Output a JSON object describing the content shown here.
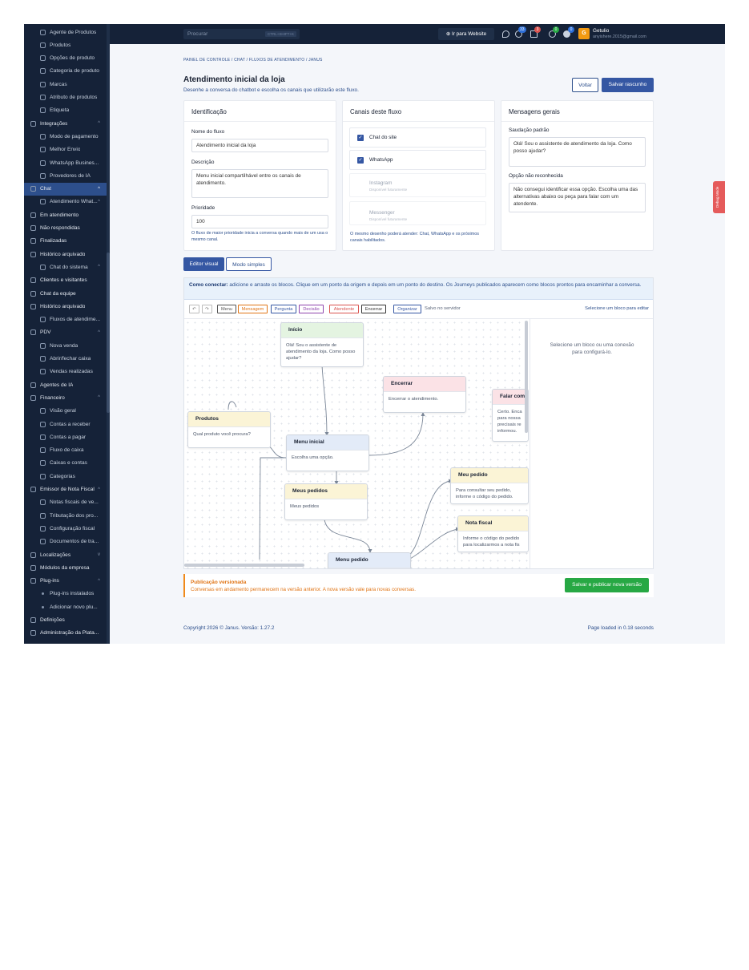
{
  "sidebar": {
    "items": [
      {
        "label": "Agente de Produtos",
        "level": "l1"
      },
      {
        "label": "Produtos",
        "level": "l1"
      },
      {
        "label": "Opções de produto",
        "level": "l1"
      },
      {
        "label": "Categoria de produto",
        "level": "l1"
      },
      {
        "label": "Marcas",
        "level": "l1"
      },
      {
        "label": "Atributo de produtos",
        "level": "l1"
      },
      {
        "label": "Etiqueta",
        "level": "l1"
      },
      {
        "label": "Integrações",
        "level": "l0",
        "caret": "^"
      },
      {
        "label": "Modo de pagamento",
        "level": "l1"
      },
      {
        "label": "Melhor Envio",
        "level": "l1"
      },
      {
        "label": "WhatsApp Busines...",
        "level": "l1"
      },
      {
        "label": "Provedores de IA",
        "level": "l1"
      },
      {
        "label": "Chat",
        "level": "l0",
        "caret": "^",
        "active": true
      },
      {
        "label": "Atendimento What...",
        "level": "l1",
        "caret": "^"
      },
      {
        "label": "Em atendimento",
        "level": "l0"
      },
      {
        "label": "Não respondidas",
        "level": "l0"
      },
      {
        "label": "Finalizadas",
        "level": "l0"
      },
      {
        "label": "Histórico arquivado",
        "level": "l0"
      },
      {
        "label": "Chat do sistema",
        "level": "l1",
        "caret": "^"
      },
      {
        "label": "Clientes e visitantes",
        "level": "l0"
      },
      {
        "label": "Chat da equipe",
        "level": "l0"
      },
      {
        "label": "Histórico arquivado",
        "level": "l0"
      },
      {
        "label": "Fluxos de atendime...",
        "level": "l1"
      },
      {
        "label": "PDV",
        "level": "l0",
        "caret": "^"
      },
      {
        "label": "Nova venda",
        "level": "l1"
      },
      {
        "label": "Abrir/fechar caixa",
        "level": "l1"
      },
      {
        "label": "Vendas realizadas",
        "level": "l1"
      },
      {
        "label": "Agentes de IA",
        "level": "l0"
      },
      {
        "label": "Financeiro",
        "level": "l0",
        "caret": "^"
      },
      {
        "label": "Visão geral",
        "level": "l1"
      },
      {
        "label": "Contas a receber",
        "level": "l1"
      },
      {
        "label": "Contas a pagar",
        "level": "l1"
      },
      {
        "label": "Fluxo de caixa",
        "level": "l1"
      },
      {
        "label": "Caixas e contas",
        "level": "l1"
      },
      {
        "label": "Categorias",
        "level": "l1"
      },
      {
        "label": "Emissor de Nota Fiscal",
        "level": "l0",
        "caret": "^"
      },
      {
        "label": "Notas fiscais de ve...",
        "level": "l1"
      },
      {
        "label": "Tributação dos pro...",
        "level": "l1"
      },
      {
        "label": "Configuração fiscal",
        "level": "l1"
      },
      {
        "label": "Documentos de tra...",
        "level": "l1"
      },
      {
        "label": "Localizações",
        "level": "l0",
        "caret": "v"
      },
      {
        "label": "Módulos da empresa",
        "level": "l0"
      },
      {
        "label": "Plug-ins",
        "level": "l0",
        "caret": "^"
      },
      {
        "label": "Plug-ins instalados",
        "level": "l2"
      },
      {
        "label": "Adicionar novo plu...",
        "level": "l2"
      },
      {
        "label": "Definições",
        "level": "l0"
      },
      {
        "label": "Administração da Plata...",
        "level": "l0"
      }
    ]
  },
  "topbar": {
    "search_placeholder": "Procurar",
    "search_shortcut": "CTRL+SHIFT+K",
    "website_label": "Ir para Website",
    "badges": {
      "notifications": "33",
      "cart": "3",
      "whatsapp": "0",
      "chat": "0"
    },
    "user_initial": "G",
    "user_name": "Getulio",
    "user_email": "anyishere.2015@gmail.com"
  },
  "breadcrumb": "PAINEL DE CONTROLE  /  CHAT  /  FLUXOS DE ATENDIMENTO  /  JANUS",
  "page": {
    "title": "Atendimento inicial da loja",
    "subtitle": "Desenhe a conversa do chatbot e escolha os canais que utilizarão este fluxo.",
    "back_label": "Voltar",
    "save_draft_label": "Salvar rascunho"
  },
  "identification": {
    "title": "Identificação",
    "name_label": "Nome do fluxo",
    "name_value": "Atendimento inicial da loja",
    "desc_label": "Descrição",
    "desc_value": "Menu inicial compartilhável entre os canais de atendimento.",
    "priority_label": "Prioridade",
    "priority_value": "100",
    "priority_hint": "O fluxo de maior prioridade inicia a conversa quando mais de um usa o mesmo canal."
  },
  "channels": {
    "title": "Canais deste fluxo",
    "items": [
      {
        "name": "Chat do site",
        "checked": true,
        "sub": ""
      },
      {
        "name": "WhatsApp",
        "checked": true,
        "sub": ""
      },
      {
        "name": "Instagram",
        "checked": false,
        "sub": "Disponível futuramente"
      },
      {
        "name": "Messenger",
        "checked": false,
        "sub": "Disponível futuramente"
      }
    ],
    "hint": "O mesmo desenho poderá atender: Chat, WhatsApp e os próximos canais habilitados."
  },
  "messages": {
    "title": "Mensagens gerais",
    "greeting_label": "Saudação padrão",
    "greeting_value": "Olá! Sou o assistente de atendimento da loja. Como posso ajudar?",
    "unknown_label": "Opção não reconhecida",
    "unknown_value": "Não consegui identificar essa opção. Escolha uma das alternativas abaixo ou peça para falar com um atendente."
  },
  "tabs": {
    "visual": "Editor visual",
    "simple": "Modo simples"
  },
  "editor": {
    "connect_title": "Como conectar:",
    "connect_text": " adicione e arraste os blocos. Clique em um ponto da origem e depois em um ponto do destino. Os Journeys publicados aparecem como blocos prontos para encaminhar a conversa.",
    "toolbar": {
      "undo": "↶",
      "redo": "↷",
      "menu": "Menu",
      "message": "Mensagem",
      "question": "Pergunta",
      "decision": "Decisão",
      "agent": "Atendente",
      "end": "Encerrar",
      "organize": "Organizar",
      "save_status": "Salvo no servidor",
      "select_hint": "Selecione um bloco para editar"
    },
    "colors": {
      "menu": "#555555",
      "message": "#e07415",
      "question": "#3557a3",
      "decision": "#8e44ad",
      "agent": "#d9534f",
      "end": "#333333",
      "organize": "#3557a3"
    },
    "nodes": [
      {
        "id": "inicio",
        "title": "Início",
        "body": "Olá! Sou o assistente de atendimento da loja. Como posso ajudar?",
        "color": "green"
      },
      {
        "id": "encerrar",
        "title": "Encerrar",
        "body": "Encerrar o atendimento.",
        "color": "red"
      },
      {
        "id": "falar",
        "title": "Falar com",
        "body": "Certo. Enca para nossa precisais re informou.",
        "color": "red"
      },
      {
        "id": "produtos",
        "title": "Produtos",
        "body": "Qual produto você procura?",
        "color": "yellow"
      },
      {
        "id": "menu",
        "title": "Menu inicial",
        "body": "Escolha uma opção.",
        "color": "blue"
      },
      {
        "id": "meus",
        "title": "Meus pedidos",
        "body": "Meus pedidos",
        "color": "yellow"
      },
      {
        "id": "meupedido",
        "title": "Meu pedido",
        "body": "Para consultar seu pedido, informe o código do pedido.",
        "color": "yellow"
      },
      {
        "id": "nota",
        "title": "Nota fiscal",
        "body": "Informe o código do pedido para localizarmos a nota fis",
        "color": "yellow"
      },
      {
        "id": "menupedido",
        "title": "Menu pedido",
        "body": "",
        "color": "blue"
      }
    ],
    "side_message": "Selecione um bloco ou uma conexão para configurá-lo."
  },
  "publish": {
    "title": "Publicação versionada",
    "text": "Conversas em andamento permanecem na versão anterior. A nova versão vale para novas conversas.",
    "button": "Salvar e publicar nova versão"
  },
  "footer": {
    "copyright": "Copyright 2026 © Janus. Versão: 1.27.2",
    "loaded": "Page loaded in 0.18 seconds"
  },
  "debug_label": "Debug Mode"
}
